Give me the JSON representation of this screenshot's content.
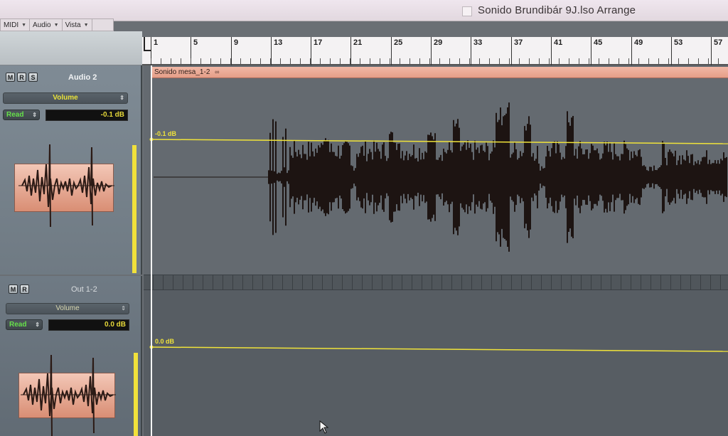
{
  "window": {
    "title": "Sonido Brundibár 9J.lso Arrange"
  },
  "menu": [
    {
      "label": "MIDI"
    },
    {
      "label": "Audio"
    },
    {
      "label": "Vista"
    }
  ],
  "ruler": {
    "bars": [
      "1",
      "5",
      "9",
      "13",
      "17",
      "21",
      "25",
      "29",
      "33",
      "37",
      "41",
      "45",
      "49",
      "53",
      "57"
    ]
  },
  "tracks": [
    {
      "name": "Audio 2",
      "buttons": [
        "M",
        "R",
        "S"
      ],
      "automation_param": "Volume",
      "automation_mode": "Read",
      "value": "-0.1 dB",
      "automation_label": "-0.1 dB",
      "region_name": "Sonido mesa_1-2",
      "region_icon": "stereo-link-icon"
    },
    {
      "name": "Out 1-2",
      "buttons": [
        "M",
        "R"
      ],
      "automation_param": "Volume",
      "automation_mode": "Read",
      "value": "0.0 dB",
      "automation_label": "0.0 dB"
    }
  ],
  "colors": {
    "region": "#e59e88",
    "automation_line": "#f0e33a",
    "read_mode": "#66e04a",
    "waveform": "#1d1412"
  }
}
